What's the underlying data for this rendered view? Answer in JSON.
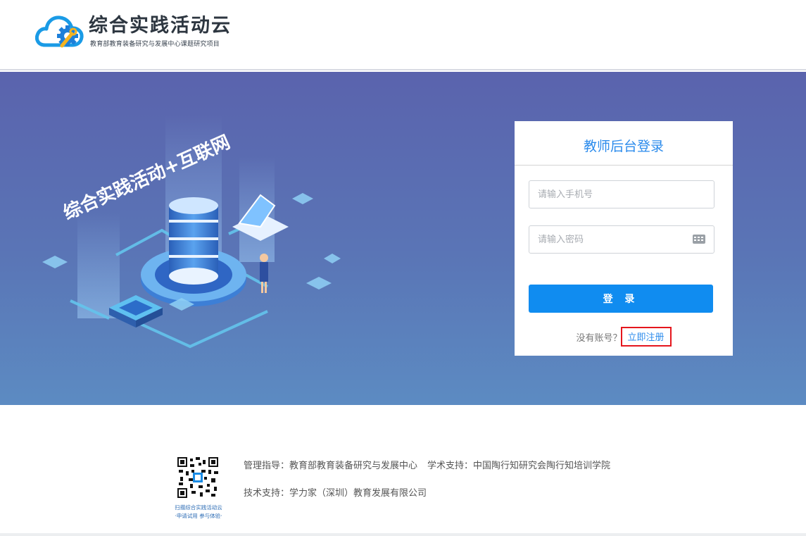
{
  "header": {
    "brand_title": "综合实践活动云",
    "brand_subtitle": "教育部教育装备研究与发展中心课题研究项目"
  },
  "hero": {
    "art_caption": "综合实践活动+互联网"
  },
  "login": {
    "title": "教师后台登录",
    "phone_placeholder": "请输入手机号",
    "password_placeholder": "请输入密码",
    "submit_label": "登 录",
    "no_account_text": "没有账号？",
    "register_link": "立即注册"
  },
  "footer": {
    "qr_caption_line1": "扫描综合实践活动云",
    "qr_caption_line2": "·申请试用 参与体验·",
    "guidance_label": "管理指导：",
    "guidance_value": "教育部教育装备研究与发展中心",
    "academic_label": "学术支持：",
    "academic_value": "中国陶行知研究会陶行知培训学院",
    "tech_label": "技术支持：",
    "tech_value": "学力家（深圳）教育发展有限公司"
  },
  "colors": {
    "accent_blue": "#108cf0",
    "title_blue": "#2b8bec",
    "highlight_red": "#e5161d",
    "hero_top": "#5a63ad",
    "hero_bottom": "#5c8bc2"
  },
  "icons": [
    "cloud-gear-logo-icon",
    "keyboard-icon",
    "qr-code-icon"
  ]
}
